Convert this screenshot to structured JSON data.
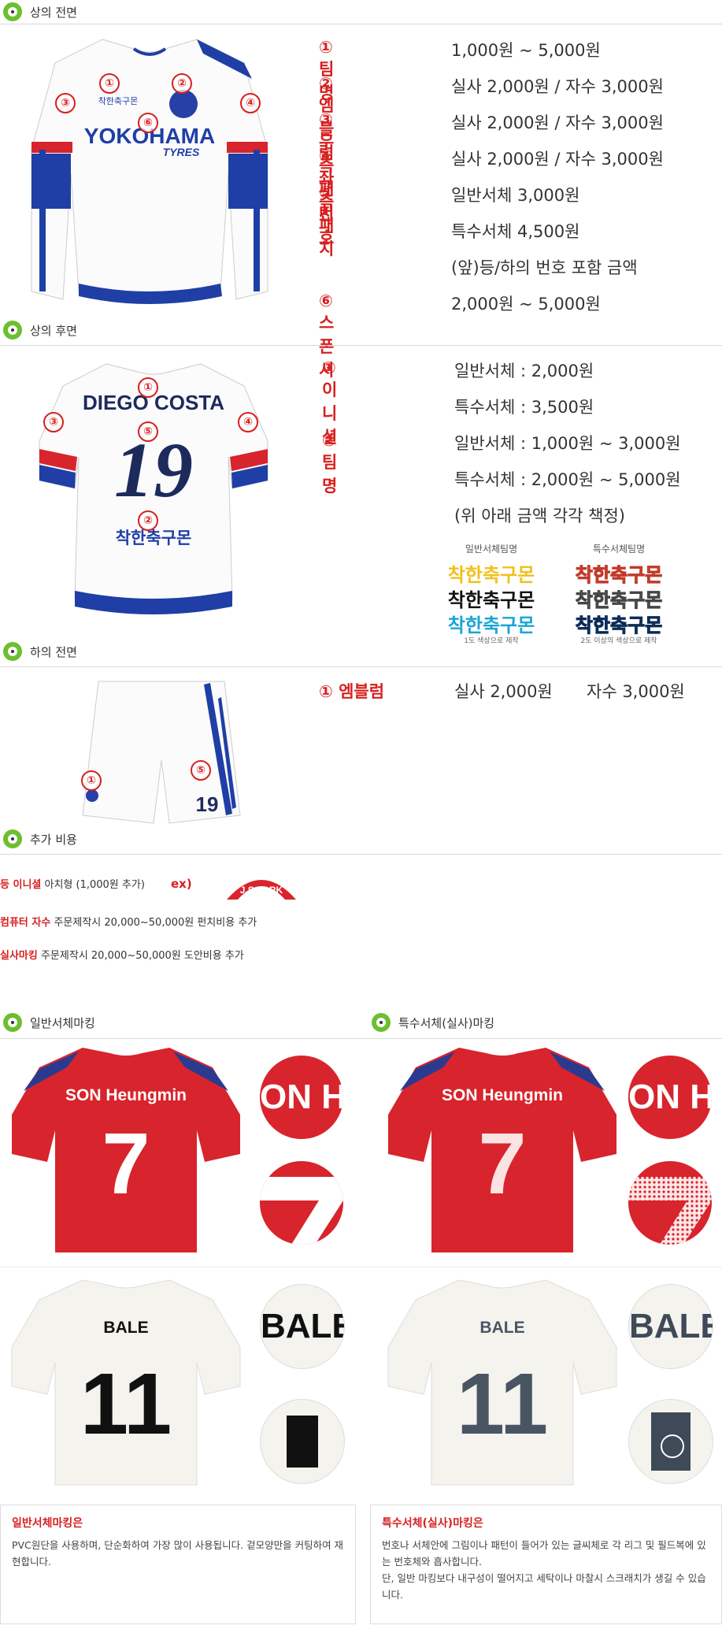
{
  "sections": {
    "front_top": "상의 전면",
    "back_top": "상의 후면",
    "front_shorts": "하의 전면",
    "extra_cost": "추가 비용",
    "normal_marking": "일반서체마킹",
    "special_marking": "특수서체(실사)마킹"
  },
  "front_prices": [
    {
      "label": "① 팀명",
      "price": "1,000원 ~ 5,000원"
    },
    {
      "label": "② 엠블럼",
      "price": "실사 2,000원 / 자수 3,000원"
    },
    {
      "label": "③ 우측패치",
      "price": "실사 2,000원 / 자수 3,000원"
    },
    {
      "label": "④ 좌측패치",
      "price": "실사 2,000원 / 자수 3,000원"
    },
    {
      "label": "⑤ 번호",
      "price": "일반서체 3,000원"
    },
    {
      "label": "",
      "price": "특수서체 4,500원"
    },
    {
      "label": "",
      "price": "(앞)등/하의 번호 포함 금액"
    },
    {
      "label": "⑥ 스폰서",
      "price": "2,000원 ~ 5,000원"
    }
  ],
  "back_prices": [
    {
      "label": "① 이니셜",
      "price": "일반서체 : 2,000원"
    },
    {
      "label": "",
      "price": "특수서체 : 3,500원"
    },
    {
      "label": "② 팀명",
      "price": "일반서체 : 1,000원 ~ 3,000원"
    },
    {
      "label": "",
      "price": "특수서체 : 2,000원 ~ 5,000원"
    },
    {
      "label": "",
      "price": "(위 아래 금액 각각 책정)"
    }
  ],
  "font_samples": {
    "normal_title": "일반서체팀명",
    "special_title": "특수서체팀명",
    "team_name": "착한축구몬",
    "normal_note": "1도 색상으로 제작",
    "special_note": "2도 이상의 색상으로 제작"
  },
  "shorts_prices": [
    {
      "label": "① 엠블럼",
      "price": "실사 2,000원",
      "price2": "자수 3,000원"
    }
  ],
  "jersey_front": {
    "team_label": "착한축구몬",
    "sponsor": "YOKOHAMA",
    "sponsor_sub": "TYRES",
    "markers": [
      "①",
      "②",
      "③",
      "④",
      "⑥"
    ]
  },
  "jersey_back": {
    "name": "DIEGO COSTA",
    "number": "19",
    "team_label": "착한축구몬",
    "markers": [
      "①",
      "②",
      "③",
      "④",
      "⑤"
    ]
  },
  "shorts": {
    "number": "19",
    "markers": [
      "①",
      "⑤"
    ]
  },
  "extra_costs": [
    {
      "key": "등 이니셜",
      "text": " 아치형 (1,000원 추가)",
      "ex": "ex)",
      "badge": "J.S.PARK"
    },
    {
      "key": "컴퓨터 자수",
      "text": " 주문제작시 20,000~50,000원 펀치비용 추가"
    },
    {
      "key": "실사마킹",
      "text": " 주문제작시 20,000~50,000원 도안비용 추가"
    }
  ],
  "marking_examples": {
    "red_name": "SON Heungmin",
    "red_number": "7",
    "red_zoom_text": "ON H",
    "white_name": "BALE",
    "white_number": "11",
    "white_zoom_text": "BALE"
  },
  "notes": {
    "normal_title": "일반서체마킹은",
    "normal_body": "PVC원단을 사용하며, 단순화하여 가장 많이 사용됩니다. 겉모양만을 커팅하여 재현합니다.",
    "special_title": "특수서체(실사)마킹은",
    "special_body_1": "번호나 서체안에 그림이나 패턴이 들어가 있는 글씨체로 각 리그 및 필드복에 있는 번호체와 흡사합니다.",
    "special_body_2": "단, 일반 마킹보다 내구성이 떨어지고 세탁이나 마찰시 스크래치가 생길 수 있습니다."
  },
  "colors": {
    "accent_red": "#d81f1f",
    "icon_green": "#6cbf2e",
    "jersey_blue": "#1f3fa6",
    "kit_red": "#d8242c"
  }
}
